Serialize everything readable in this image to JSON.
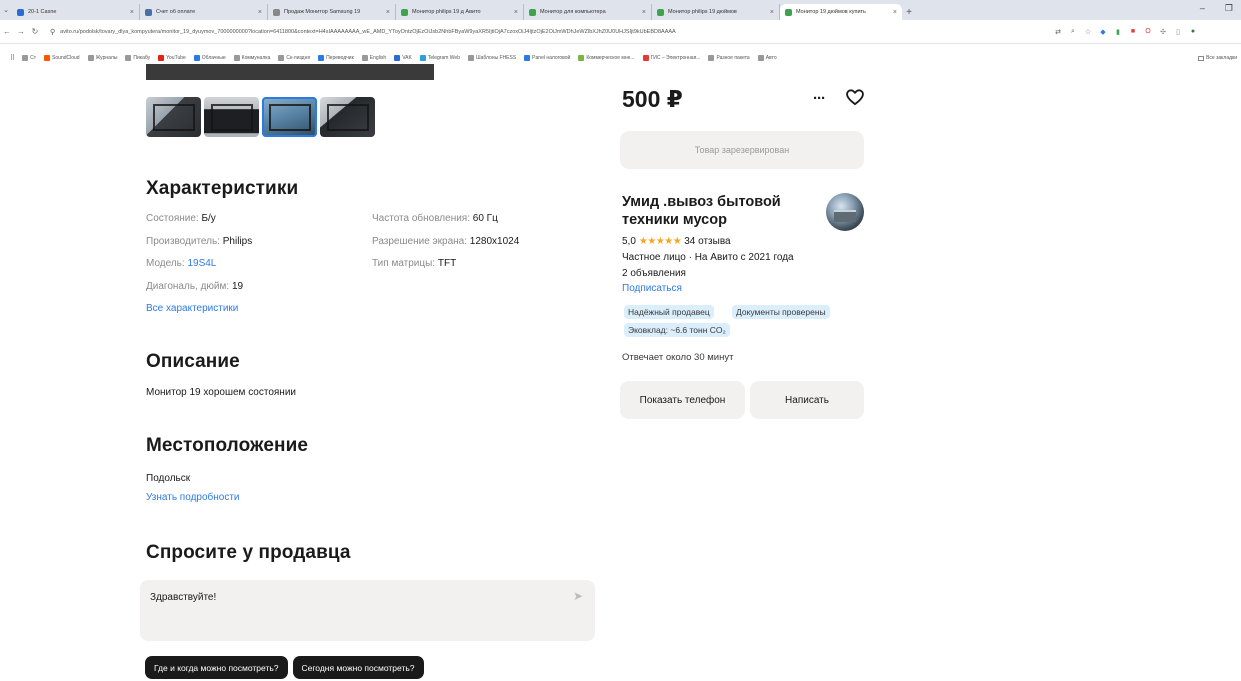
{
  "browser": {
    "tabs": [
      {
        "title": "20-1 Casne",
        "fav_color": "#2c6bd1"
      },
      {
        "title": "Счет об оплате",
        "fav_color": "#4a6fa5"
      },
      {
        "title": "Продаж Монитор Samsung 19",
        "fav_color": "#888888"
      },
      {
        "title": "Монитор philips 19 д Авито",
        "fav_color": "#3fa34d"
      },
      {
        "title": "Монитор для компьютера",
        "fav_color": "#3fa34d"
      },
      {
        "title": "Монитор philips 19 дюймов",
        "fav_color": "#3fa34d"
      },
      {
        "title": "Монитор 19 дюймов купить",
        "fav_color": "#3fa34d",
        "active": true
      }
    ],
    "url": "avito.ru/podolsk/tovary_dlya_kompyutera/monitor_19_dyuymov_7000000000?location=6411800&context=H4sIAAAAAAAA_wE_AMD_YToyOntzOjEzOiJsb2NhbFByaW9yaXR5IjtiOjA7czoxOiJ4IjtzOjE2OiJmWDhJeWZlbXJhZ0U0UHJSIjt9kUbEBD8AAAA",
    "bookmarks": [
      {
        "label": "Ст",
        "color": "#999999"
      },
      {
        "label": "SoundCloud",
        "color": "#ff5500"
      },
      {
        "label": "Журналы",
        "color": "#999999"
      },
      {
        "label": "Пикабу",
        "color": "#999999"
      },
      {
        "label": "YouTube",
        "color": "#e62117"
      },
      {
        "label": "Облачные",
        "color": "#2c7be5"
      },
      {
        "label": "Коммуналка",
        "color": "#999999"
      },
      {
        "label": "Ск-лиздня",
        "color": "#999999"
      },
      {
        "label": "Переводчик",
        "color": "#2c7be5"
      },
      {
        "label": "English",
        "color": "#999999"
      },
      {
        "label": "VAK",
        "color": "#2c6bd1"
      },
      {
        "label": "Telegram Web",
        "color": "#2aa1da"
      },
      {
        "label": "Шаблоны FHESS",
        "color": "#999999"
      },
      {
        "label": "Panel налоговой",
        "color": "#2c7be5"
      },
      {
        "label": "Коммерческое мне...",
        "color": "#7cb342"
      },
      {
        "label": "ГИС – Электронная...",
        "color": "#e53935"
      },
      {
        "label": "Разное пакета",
        "color": "#999999"
      },
      {
        "label": "Авто",
        "color": "#999999"
      }
    ],
    "bookmarks_right": "Все закладки"
  },
  "listing": {
    "characteristics": {
      "title": "Характеристики",
      "left": [
        {
          "key": "Состояние:",
          "value": "Б/у"
        },
        {
          "key": "Производитель:",
          "value": "Philips"
        },
        {
          "key": "Модель:",
          "value": "19S4L",
          "is_link": true
        },
        {
          "key": "Диагональ, дюйм:",
          "value": "19"
        }
      ],
      "right": [
        {
          "key": "Частота обновления:",
          "value": "60 Гц"
        },
        {
          "key": "Разрешение экрана:",
          "value": "1280x1024"
        },
        {
          "key": "Тип матрицы:",
          "value": "TFT"
        }
      ],
      "all_link": "Все характеристики"
    },
    "description": {
      "title": "Описание",
      "text": "Монитор 19 хорошем состоянии"
    },
    "location": {
      "title": "Местоположение",
      "city": "Подольск",
      "details_link": "Узнать подробности"
    },
    "ask": {
      "title": "Спросите у продавца",
      "message": "Здравствуйте!",
      "quick_replies": [
        "Где и когда можно посмотреть?",
        "Сегодня можно посмотреть?"
      ]
    }
  },
  "sidebar": {
    "price": "500 ₽",
    "reserved_label": "Товар зарезервирован",
    "seller": {
      "name": "Умид .вывоз бытовой техники мусор",
      "rating": "5,0",
      "stars": "★★★★★",
      "reviews": "34 отзыва",
      "since": "Частное лицо · На Авито с 2021 года",
      "listings": "2 объявления",
      "subscribe": "Подписаться",
      "badges": [
        "Надёжный продавец",
        "Документы проверены",
        "Эковклад: ~6.6 тонн CO₂"
      ],
      "reply_time": "Отвечает около 30 минут"
    },
    "buttons": {
      "phone": "Показать телефон",
      "write": "Написать"
    }
  }
}
